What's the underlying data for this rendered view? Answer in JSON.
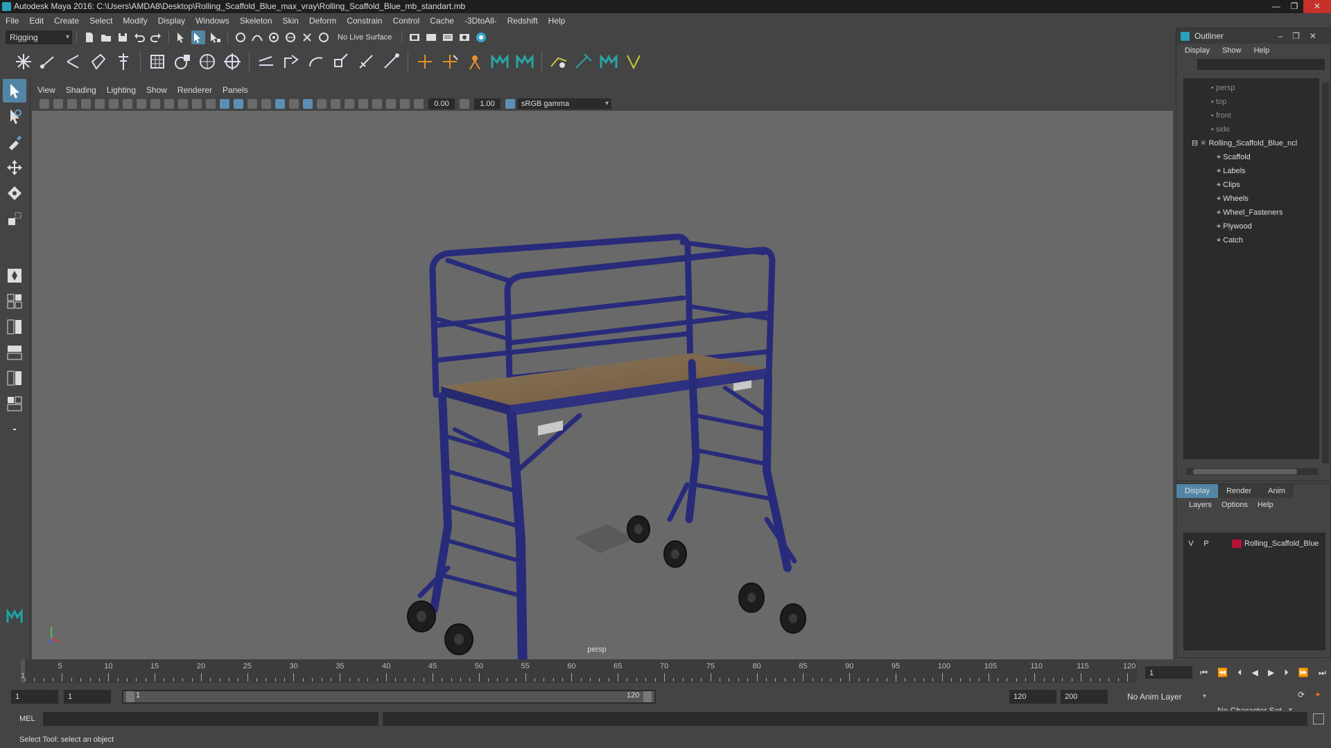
{
  "window": {
    "title": "Autodesk Maya 2016: C:\\Users\\AMDA8\\Desktop\\Rolling_Scaffold_Blue_max_vray\\Rolling_Scaffold_Blue_mb_standart.mb"
  },
  "menubar": [
    "File",
    "Edit",
    "Create",
    "Select",
    "Modify",
    "Display",
    "Windows",
    "Skeleton",
    "Skin",
    "Deform",
    "Constrain",
    "Control",
    "Cache",
    "-3DtoAll-",
    "Redshift",
    "Help"
  ],
  "statusline": {
    "menuset": "Rigging",
    "live_surface": "No Live Surface"
  },
  "panel": {
    "menus": [
      "View",
      "Shading",
      "Lighting",
      "Show",
      "Renderer",
      "Panels"
    ],
    "exposure": "0.00",
    "gamma": "1.00",
    "colorspace": "sRGB gamma",
    "camera": "persp"
  },
  "outliner": {
    "title": "Outliner",
    "menus": [
      "Display",
      "Show",
      "Help"
    ],
    "cameras": [
      "persp",
      "top",
      "front",
      "side"
    ],
    "root": "Rolling_Scaffold_Blue_ncl",
    "children": [
      "Scaffold",
      "Labels",
      "Clips",
      "Wheels",
      "Wheel_Fasteners",
      "Plywood",
      "Catch"
    ]
  },
  "layers": {
    "tabs": [
      "Display",
      "Render",
      "Anim"
    ],
    "menus": [
      "Layers",
      "Options",
      "Help"
    ],
    "row": {
      "v": "V",
      "p": "P",
      "name": "Rolling_Scaffold_Blue",
      "color": "#b5123a"
    }
  },
  "timeline": {
    "ticks": [
      "5",
      "10",
      "15",
      "20",
      "25",
      "30",
      "35",
      "40",
      "45",
      "50",
      "55",
      "60",
      "65",
      "70",
      "75",
      "80",
      "85",
      "90",
      "95",
      "100",
      "105",
      "110",
      "115",
      "120"
    ],
    "start_label": "1",
    "current_frame": "1"
  },
  "range": {
    "start": "1",
    "inner_start": "1",
    "slider_start": "1",
    "slider_end": "120",
    "end": "120",
    "max": "200",
    "anim_layer": "No Anim Layer",
    "character_set": "No Character Set"
  },
  "cmdline": {
    "label": "MEL"
  },
  "helpline": {
    "text": "Select Tool: select an object"
  }
}
